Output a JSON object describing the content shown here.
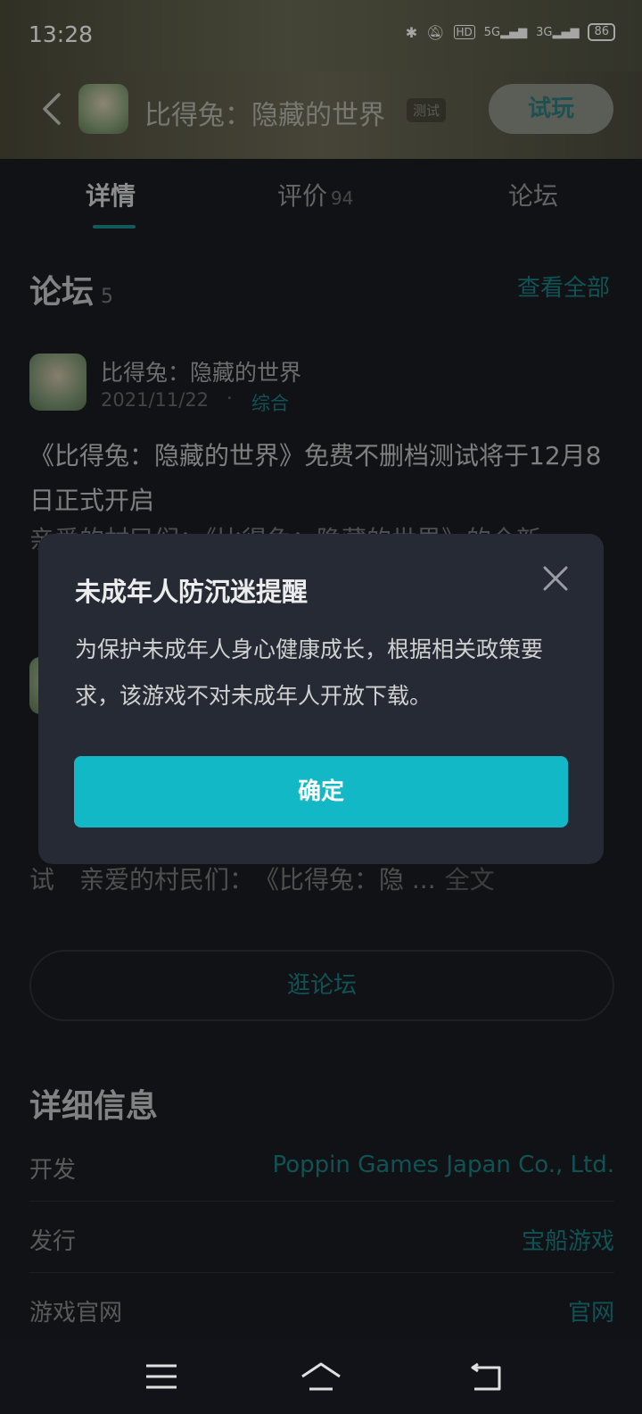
{
  "status_bar": {
    "time": "13:28",
    "battery": "86",
    "icons": [
      "bluetooth-icon",
      "mute-icon",
      "hd-icon",
      "5g-signal-icon",
      "3g-signal-icon",
      "battery-icon"
    ]
  },
  "header": {
    "back_icon": "chevron-left-icon",
    "app_title": "比得兔：隐藏的世界",
    "beta_tag": "测试",
    "try_button": "试玩"
  },
  "tabs": [
    {
      "label": "详情",
      "active": true
    },
    {
      "label": "评价",
      "count": "94",
      "active": false
    },
    {
      "label": "论坛",
      "active": false
    }
  ],
  "forum": {
    "title": "论坛",
    "count": "5",
    "view_all": "查看全部",
    "post1": {
      "author": "比得兔：隐藏的世界",
      "date": "2021/11/22",
      "dot": "·",
      "category": "综合",
      "title": "《比得兔：隐藏的世界》免费不删档测试将于12月8日正式开启",
      "snippet": "亲爱的村民们：《比得兔：隐藏的世界》的全新..."
    },
    "post2": {
      "snippet": "试　亲爱的村民们：　《比得兔：隐 ...",
      "full_text": "全文"
    },
    "browse_button": "逛论坛"
  },
  "details": {
    "title": "详细信息",
    "rows": [
      {
        "label": "开发",
        "value": "Poppin Games Japan Co., Ltd."
      },
      {
        "label": "发行",
        "value": "宝船游戏"
      },
      {
        "label": "游戏官网",
        "value": "官网"
      }
    ]
  },
  "dialog": {
    "title": "未成年人防沉迷提醒",
    "body": "为保护未成年人身心健康成长，根据相关政策要求，该游戏不对未成年人开放下载。",
    "confirm": "确定"
  },
  "colors": {
    "accent": "#13b8c7",
    "link": "#1b7e83",
    "background": "#1a1d22",
    "dialog": "#262a35"
  }
}
